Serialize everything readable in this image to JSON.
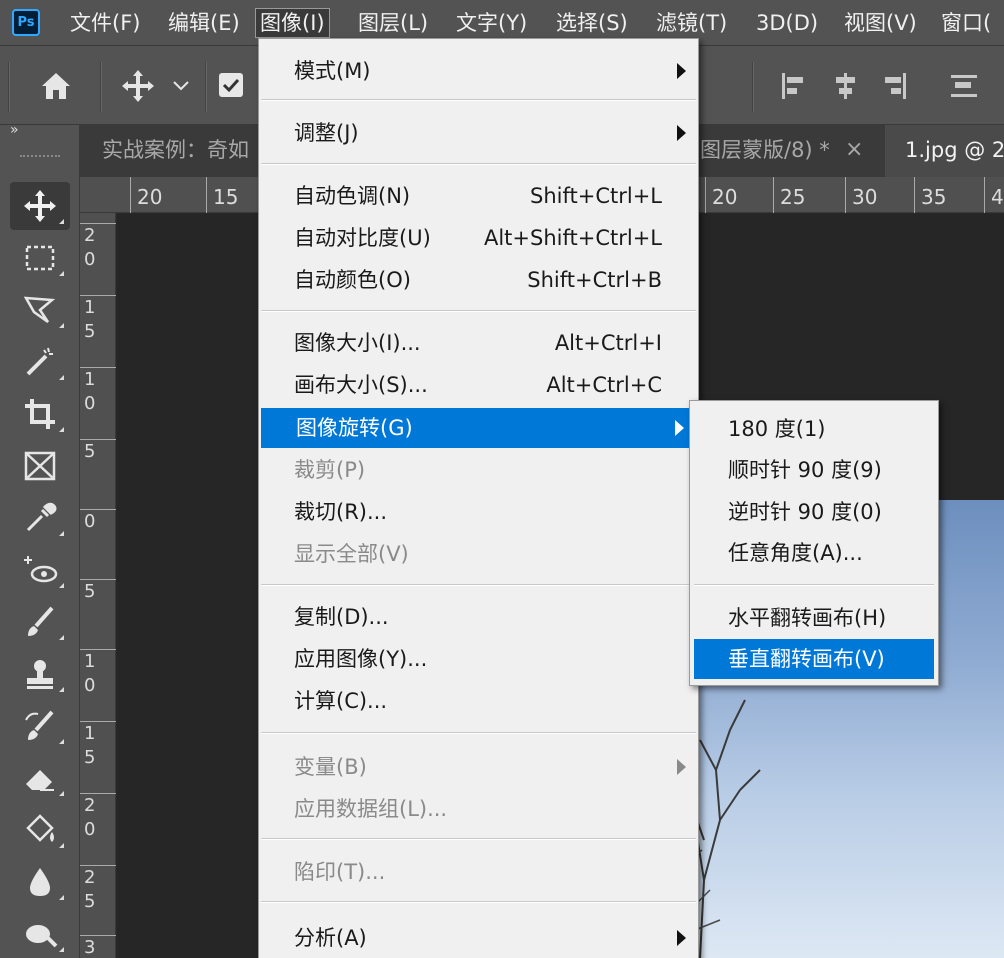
{
  "app": {
    "logo": "Ps"
  },
  "menubar": {
    "items": [
      {
        "label": "文件(F)"
      },
      {
        "label": "编辑(E)"
      },
      {
        "label": "图像(I)"
      },
      {
        "label": "图层(L)"
      },
      {
        "label": "文字(Y)"
      },
      {
        "label": "选择(S)"
      },
      {
        "label": "滤镜(T)"
      },
      {
        "label": "3D(D)"
      },
      {
        "label": "视图(V)"
      },
      {
        "label": "窗口("
      }
    ]
  },
  "tabs": [
    {
      "label": "实战案例：奇如"
    },
    {
      "label": "图层蒙版/8) *"
    },
    {
      "label": "1.jpg @ 2"
    }
  ],
  "tab_close": "×",
  "toolbar": {
    "collapse": "»"
  },
  "ruler": {
    "top": [
      "20",
      "15",
      "20",
      "25",
      "30",
      "35",
      "4"
    ],
    "left": [
      [
        "2",
        "0"
      ],
      [
        "1",
        "5"
      ],
      [
        "1",
        "0"
      ],
      [
        "5"
      ],
      [
        "0"
      ],
      [
        "5"
      ],
      [
        "1",
        "0"
      ],
      [
        "1",
        "5"
      ],
      [
        "2",
        "0"
      ],
      [
        "2",
        "5"
      ],
      [
        "3"
      ]
    ]
  },
  "image_menu": {
    "items": [
      {
        "label": "模式(M)",
        "shortcut": "",
        "submenu": true,
        "disabled": false
      },
      {
        "label": "调整(J)",
        "shortcut": "",
        "submenu": true,
        "disabled": false
      },
      {
        "label": "自动色调(N)",
        "shortcut": "Shift+Ctrl+L",
        "submenu": false,
        "disabled": false
      },
      {
        "label": "自动对比度(U)",
        "shortcut": "Alt+Shift+Ctrl+L",
        "submenu": false,
        "disabled": false
      },
      {
        "label": "自动颜色(O)",
        "shortcut": "Shift+Ctrl+B",
        "submenu": false,
        "disabled": false
      },
      {
        "label": "图像大小(I)...",
        "shortcut": "Alt+Ctrl+I",
        "submenu": false,
        "disabled": false
      },
      {
        "label": "画布大小(S)...",
        "shortcut": "Alt+Ctrl+C",
        "submenu": false,
        "disabled": false
      },
      {
        "label": "图像旋转(G)",
        "shortcut": "",
        "submenu": true,
        "disabled": false,
        "highlighted": true
      },
      {
        "label": "裁剪(P)",
        "shortcut": "",
        "submenu": false,
        "disabled": true
      },
      {
        "label": "裁切(R)...",
        "shortcut": "",
        "submenu": false,
        "disabled": false
      },
      {
        "label": "显示全部(V)",
        "shortcut": "",
        "submenu": false,
        "disabled": true
      },
      {
        "label": "复制(D)...",
        "shortcut": "",
        "submenu": false,
        "disabled": false
      },
      {
        "label": "应用图像(Y)...",
        "shortcut": "",
        "submenu": false,
        "disabled": false
      },
      {
        "label": "计算(C)...",
        "shortcut": "",
        "submenu": false,
        "disabled": false
      },
      {
        "label": "变量(B)",
        "shortcut": "",
        "submenu": true,
        "disabled": true
      },
      {
        "label": "应用数据组(L)...",
        "shortcut": "",
        "submenu": false,
        "disabled": true
      },
      {
        "label": "陷印(T)...",
        "shortcut": "",
        "submenu": false,
        "disabled": true
      },
      {
        "label": "分析(A)",
        "shortcut": "",
        "submenu": true,
        "disabled": false
      }
    ]
  },
  "rotate_submenu": {
    "items": [
      {
        "label": "180 度(1)"
      },
      {
        "label": "顺时针 90 度(9)"
      },
      {
        "label": "逆时针 90 度(0)"
      },
      {
        "label": "任意角度(A)..."
      },
      {
        "label": "水平翻转画布(H)"
      },
      {
        "label": "垂直翻转画布(V)",
        "highlighted": true
      }
    ]
  },
  "colors": {
    "highlight": "#0078d7",
    "menu_bg": "#f0f0f0",
    "chrome": "#535353"
  }
}
